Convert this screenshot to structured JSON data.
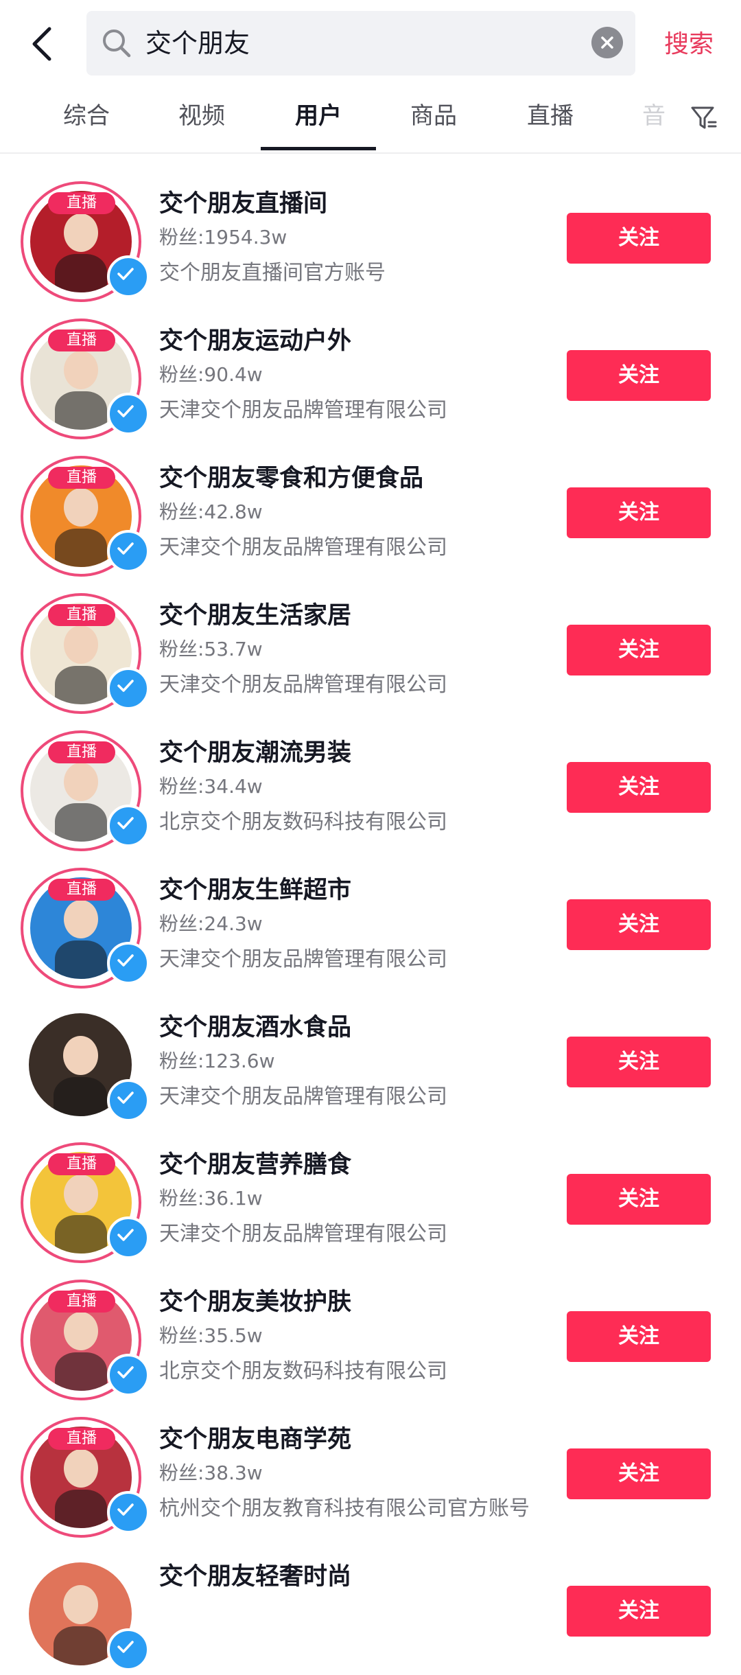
{
  "search": {
    "query": "交个朋友",
    "button_label": "搜索",
    "icons": {
      "back": "back-arrow-icon",
      "search": "search-icon",
      "clear": "clear-icon",
      "filter": "filter-icon"
    }
  },
  "tabs": [
    {
      "label": "综合"
    },
    {
      "label": "视频"
    },
    {
      "label": "用户",
      "active": true
    },
    {
      "label": "商品"
    },
    {
      "label": "直播"
    },
    {
      "label": "音"
    }
  ],
  "colors": {
    "accent": "#fe2c55",
    "search_text": "#e83a5c",
    "verified": "#2a9df4",
    "live_ring": "#ee4a7a"
  },
  "live_label": "直播",
  "follow_label": "关注",
  "users": [
    {
      "name": "交个朋友直播间",
      "fans": "粉丝:1954.3w",
      "desc": "交个朋友直播间官方账号",
      "live": true,
      "bg": "#b41e2a"
    },
    {
      "name": "交个朋友运动户外",
      "fans": "粉丝:90.4w",
      "desc": "天津交个朋友品牌管理有限公司",
      "live": true,
      "bg": "#e9e3d6"
    },
    {
      "name": "交个朋友零食和方便食品",
      "fans": "粉丝:42.8w",
      "desc": "天津交个朋友品牌管理有限公司",
      "live": true,
      "bg": "#f08a2a"
    },
    {
      "name": "交个朋友生活家居",
      "fans": "粉丝:53.7w",
      "desc": "天津交个朋友品牌管理有限公司",
      "live": true,
      "bg": "#efe6d4"
    },
    {
      "name": "交个朋友潮流男装",
      "fans": "粉丝:34.4w",
      "desc": "北京交个朋友数码科技有限公司",
      "live": true,
      "bg": "#ece9e4"
    },
    {
      "name": "交个朋友生鲜超市",
      "fans": "粉丝:24.3w",
      "desc": "天津交个朋友品牌管理有限公司",
      "live": true,
      "bg": "#2d86d8"
    },
    {
      "name": "交个朋友酒水食品",
      "fans": "粉丝:123.6w",
      "desc": "天津交个朋友品牌管理有限公司",
      "live": false,
      "bg": "#3a2e27"
    },
    {
      "name": "交个朋友营养膳食",
      "fans": "粉丝:36.1w",
      "desc": "天津交个朋友品牌管理有限公司",
      "live": true,
      "bg": "#f3c43a"
    },
    {
      "name": "交个朋友美妆护肤",
      "fans": "粉丝:35.5w",
      "desc": "北京交个朋友数码科技有限公司",
      "live": true,
      "bg": "#e05a6e"
    },
    {
      "name": "交个朋友电商学苑",
      "fans": "粉丝:38.3w",
      "desc": "杭州交个朋友教育科技有限公司官方账号",
      "live": true,
      "bg": "#b8323e"
    },
    {
      "name": "交个朋友轻奢时尚",
      "fans": "",
      "desc": "",
      "live": false,
      "bg": "#e0745a"
    }
  ]
}
